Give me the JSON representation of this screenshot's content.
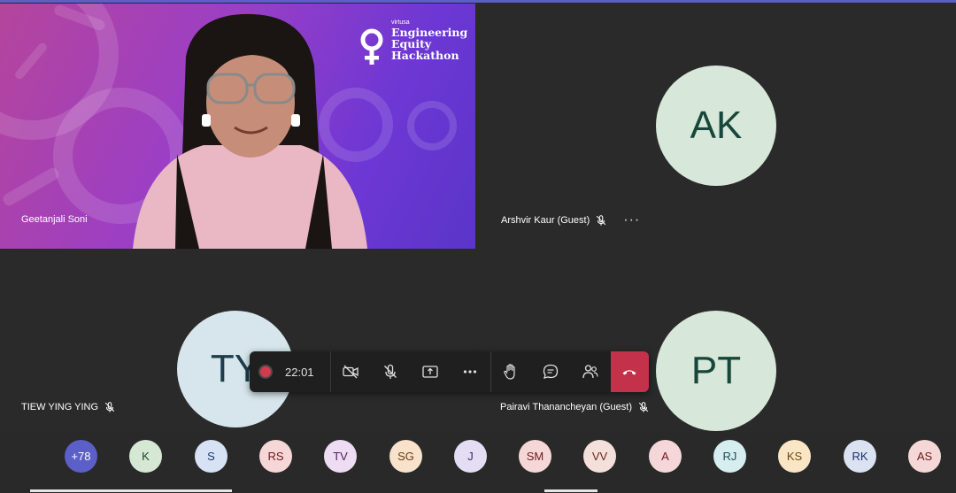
{
  "tiles": [
    {
      "id": "gs",
      "name": "Geetanjali Soni",
      "muted": false
    },
    {
      "id": "ak",
      "name": "Arshvir Kaur (Guest)",
      "initials": "AK",
      "muted": true,
      "more": "···"
    },
    {
      "id": "ty",
      "name": "TIEW YING YING",
      "initials": "TY",
      "muted": true
    },
    {
      "id": "pt",
      "name": "Pairavi Thanancheyan (Guest)",
      "initials": "PT",
      "muted": true
    }
  ],
  "branding": {
    "small": "virtusa",
    "line1": "Engineering",
    "line2": "Equity",
    "line3": "Hackathon"
  },
  "call_bar": {
    "timer": "22:01",
    "icons": [
      "record-icon",
      "camera-off-icon",
      "mic-off-icon",
      "share-screen-icon",
      "more-icon",
      "raise-hand-icon",
      "chat-icon",
      "people-icon",
      "hang-up-icon"
    ]
  },
  "roster": [
    {
      "label": "+78",
      "bg": "#5b5fc7",
      "fg": "#ffffff"
    },
    {
      "label": "K",
      "bg": "#d5e8d4",
      "fg": "#1e4620"
    },
    {
      "label": "S",
      "bg": "#d7e3f4",
      "fg": "#1a3a6b"
    },
    {
      "label": "RS",
      "bg": "#f6d7d7",
      "fg": "#6b1a1a"
    },
    {
      "label": "TV",
      "bg": "#eddcf2",
      "fg": "#4a1f5c"
    },
    {
      "label": "SG",
      "bg": "#f8e2cc",
      "fg": "#6b3a10"
    },
    {
      "label": "J",
      "bg": "#e4def5",
      "fg": "#3a2a6b"
    },
    {
      "label": "SM",
      "bg": "#f6d7d7",
      "fg": "#6b1a1a"
    },
    {
      "label": "VV",
      "bg": "#f4e0db",
      "fg": "#6b2a1a"
    },
    {
      "label": "A",
      "bg": "#f5d7d9",
      "fg": "#6b1a22"
    },
    {
      "label": "RJ",
      "bg": "#d6eef0",
      "fg": "#1a4e55"
    },
    {
      "label": "KS",
      "bg": "#fae6c5",
      "fg": "#6b4a10"
    },
    {
      "label": "RK",
      "bg": "#dbe3f2",
      "fg": "#1a2e6b"
    },
    {
      "label": "AS",
      "bg": "#f6d7d7",
      "fg": "#6b1a1a"
    }
  ]
}
